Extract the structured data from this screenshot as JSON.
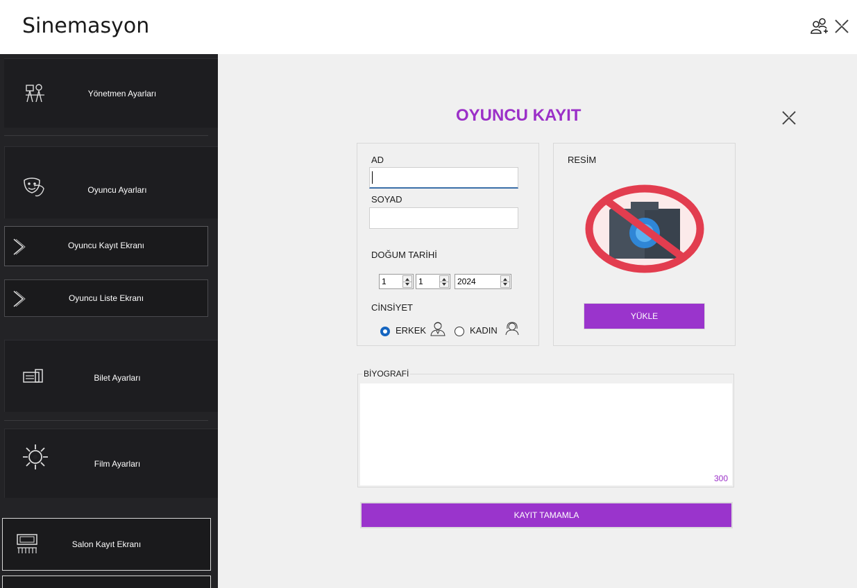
{
  "app": {
    "title": "Sinemasyon"
  },
  "titlebar": {
    "add_user_icon": "add-user-icon",
    "close_icon": "close-icon"
  },
  "sidebar": {
    "director": {
      "label": "Yönetmen  Ayarları",
      "icon": "director-icon"
    },
    "actor": {
      "label": "Oyuncu Ayarları",
      "icon": "theater-masks-icon"
    },
    "actor_register": {
      "label": "Oyuncu Kayıt Ekranı",
      "icon": "chevron-right-icon"
    },
    "actor_list": {
      "label": "Oyuncu Liste Ekranı",
      "icon": "chevron-right-icon"
    },
    "ticket": {
      "label": "Bilet Ayarları",
      "icon": "ticket-icon"
    },
    "film": {
      "label": "Film Ayarları",
      "icon": "gear-icon"
    },
    "hall_register": {
      "label": "Salon Kayıt Ekranı",
      "icon": "cinema-hall-icon"
    }
  },
  "form": {
    "title": "OYUNCU KAYIT",
    "ad_label": "AD",
    "ad_value": "",
    "soyad_label": "SOYAD",
    "soyad_value": "",
    "dogum_label": "DOĞUM TARİHİ",
    "day": "1",
    "month": "1",
    "year": "2024",
    "cinsiyet_label": "CİNSİYET",
    "male_label": "ERKEK",
    "female_label": "KADIN",
    "selected_gender": "ERKEK",
    "resim_label": "RESİM",
    "upload_label": "YÜKLE",
    "bio_label": "BİYOGRAFİ",
    "bio_value": "",
    "bio_counter": "300",
    "submit_label": "KAYIT TAMAMLA"
  },
  "colors": {
    "accent": "#9a34cc",
    "sidebar": "#232326",
    "main_bg": "#f0f0f0",
    "radio_selected": "#1565c0"
  }
}
